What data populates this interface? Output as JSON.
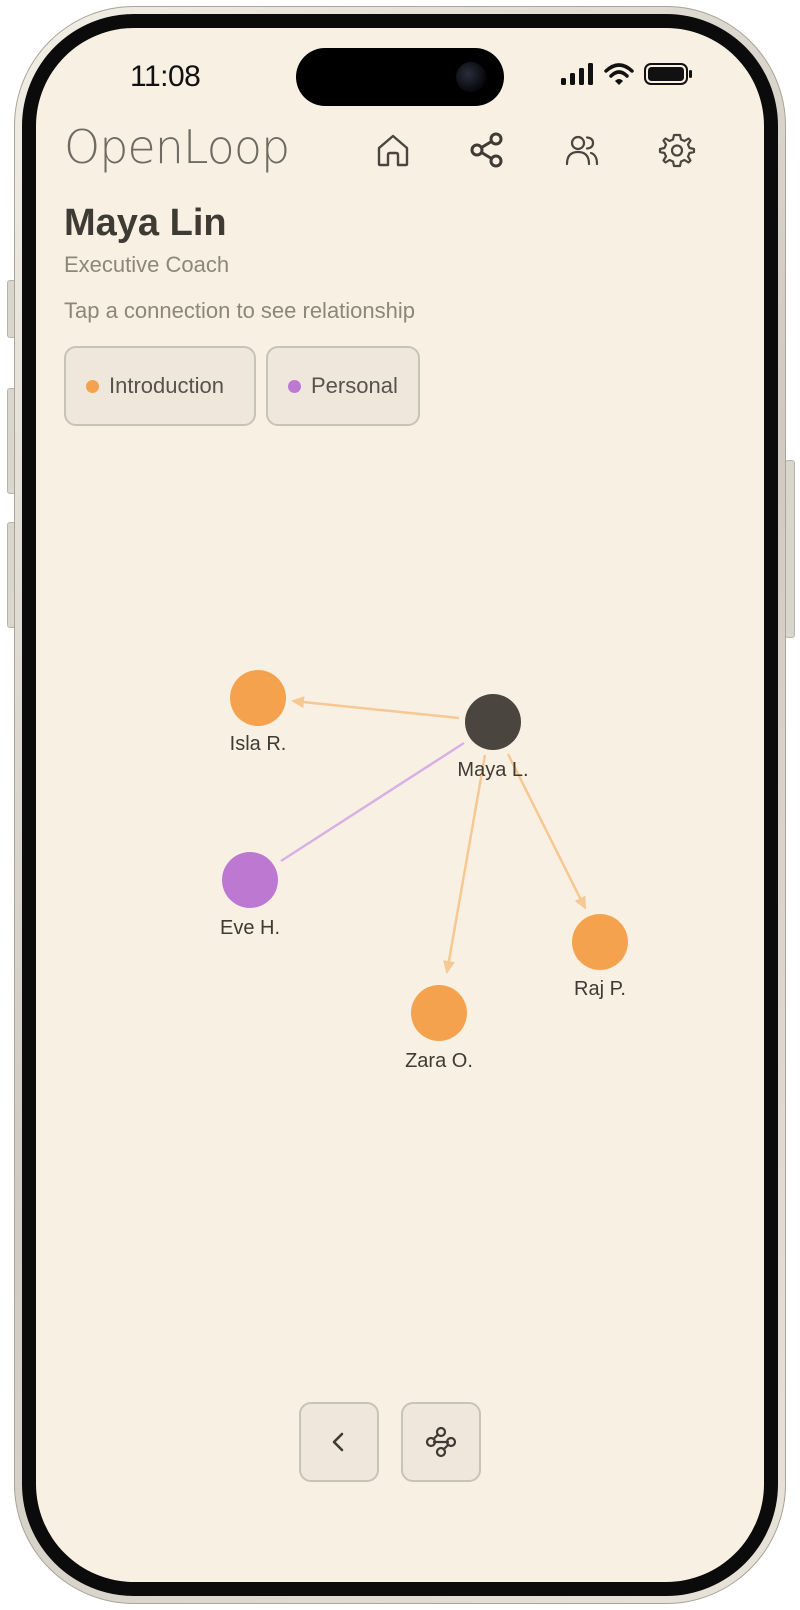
{
  "status_bar": {
    "time": "11:08"
  },
  "header": {
    "app_name": "OpenLoop",
    "nav": [
      {
        "icon": "home-icon"
      },
      {
        "icon": "share-icon"
      },
      {
        "icon": "users-icon"
      },
      {
        "icon": "settings-icon"
      }
    ]
  },
  "profile": {
    "name": "Maya Lin",
    "role": "Executive Coach",
    "hint": "Tap a connection to see relationship"
  },
  "legend": [
    {
      "label": "Introduction",
      "color": "#f5a24f"
    },
    {
      "label": "Personal",
      "color": "#bd79d1"
    }
  ],
  "graph": {
    "center": {
      "label": "Maya L.",
      "color": "#4a453f"
    },
    "nodes": [
      {
        "label": "Isla R.",
        "type": "Introduction"
      },
      {
        "label": "Eve H.",
        "type": "Personal"
      },
      {
        "label": "Zara O.",
        "type": "Introduction"
      },
      {
        "label": "Raj P.",
        "type": "Introduction"
      }
    ]
  },
  "bottom_bar": [
    {
      "icon": "chevron-left-icon"
    },
    {
      "icon": "graph-layout-icon"
    }
  ]
}
